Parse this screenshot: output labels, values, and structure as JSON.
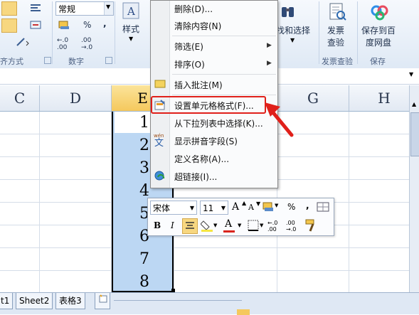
{
  "ribbon": {
    "number_format_value": "常规",
    "percent": "%",
    "comma": ",",
    "dec_inc": "←.0 .00",
    "dec_dec": ".00 →.0",
    "styles_label": "样式",
    "group_alignment": "齐方式",
    "group_number": "数字",
    "find_select_label": "找和选择",
    "invoice_label_1": "发票",
    "invoice_label_2": "查验",
    "invoice_group": "发票查验",
    "baidu_label_1": "保存到百",
    "baidu_label_2": "度网盘",
    "save_group": "保存"
  },
  "columns": {
    "c": "C",
    "d": "D",
    "e": "E",
    "g": "G",
    "h": "H"
  },
  "cells": [
    "1",
    "2",
    "3",
    "4",
    "5",
    "6",
    "7",
    "8"
  ],
  "context_menu": {
    "delete": "删除(D)...",
    "clear": "清除内容(N)",
    "filter": "筛选(E)",
    "sort": "排序(O)",
    "insert_comment": "插入批注(M)",
    "format_cells": "设置单元格格式(F)...",
    "pick_list": "从下拉列表中选择(K)...",
    "phonetic": "显示拼音字段(S)",
    "define_name": "定义名称(A)...",
    "hyperlink": "超链接(I)..."
  },
  "mini_toolbar": {
    "font": "宋体",
    "size": "11",
    "grow": "A",
    "shrink": "A",
    "percent": "%",
    "comma": ",",
    "bold": "B",
    "italic": "I",
    "font_color": "A"
  },
  "sheet_tabs": {
    "sheet1": "t1",
    "sheet2": "Sheet2",
    "sheet3": "表格3"
  },
  "colors": {
    "highlight": "#e0201a",
    "selection": "#bcd7f3",
    "header_selected": "#f5c85d"
  }
}
